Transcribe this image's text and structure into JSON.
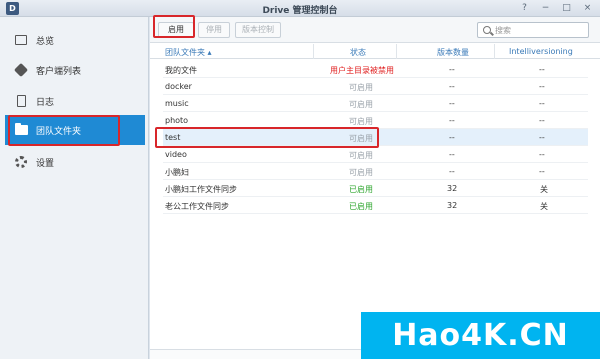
{
  "window": {
    "title": "Drive 管理控制台",
    "app_icon": "drive-app-icon",
    "app_icon_letter": "D",
    "controls": [
      "?",
      "−",
      "□",
      "×"
    ]
  },
  "sidebar": {
    "items": [
      {
        "label": "总览",
        "icon": "overview-icon"
      },
      {
        "label": "客户端列表",
        "icon": "client-list-icon"
      },
      {
        "label": "日志",
        "icon": "log-icon"
      },
      {
        "label": "团队文件夹",
        "icon": "team-folder-icon",
        "active": true
      },
      {
        "label": "设置",
        "icon": "gear-icon"
      }
    ]
  },
  "toolbar": {
    "enable_label": "启用",
    "disable_label": "停用",
    "version_label": "版本控制",
    "search_placeholder": "搜索"
  },
  "table": {
    "headers": [
      "团队文件夹 ▴",
      "状态",
      "版本数量",
      "Intelliversioning"
    ],
    "rows": [
      {
        "name": "我的文件",
        "status": "用户主目录被禁用",
        "versions": "--",
        "intelli": "--",
        "status_type": "red"
      },
      {
        "name": "docker",
        "status": "可启用",
        "versions": "--",
        "intelli": "--",
        "status_type": "gray"
      },
      {
        "name": "music",
        "status": "可启用",
        "versions": "--",
        "intelli": "--",
        "status_type": "gray"
      },
      {
        "name": "photo",
        "status": "可启用",
        "versions": "--",
        "intelli": "--",
        "status_type": "gray"
      },
      {
        "name": "test",
        "status": "可启用",
        "versions": "--",
        "intelli": "--",
        "status_type": "gray",
        "selected": true
      },
      {
        "name": "video",
        "status": "可启用",
        "versions": "--",
        "intelli": "--",
        "status_type": "gray"
      },
      {
        "name": "小鹏妇",
        "status": "可启用",
        "versions": "--",
        "intelli": "--",
        "status_type": "gray"
      },
      {
        "name": "小鹏妇工作文件同步",
        "status": "已启用",
        "versions": "32",
        "intelli": "关",
        "status_type": "green"
      },
      {
        "name": "老公工作文件同步",
        "status": "已启用",
        "versions": "32",
        "intelli": "关",
        "status_type": "green"
      }
    ]
  },
  "watermark": {
    "text": "Hao4K.CN"
  },
  "colors": {
    "accent": "#1f8ad4",
    "highlight_box": "#d8262a",
    "status_enabled": "#2ea52e",
    "status_disabled": "#e02020"
  }
}
